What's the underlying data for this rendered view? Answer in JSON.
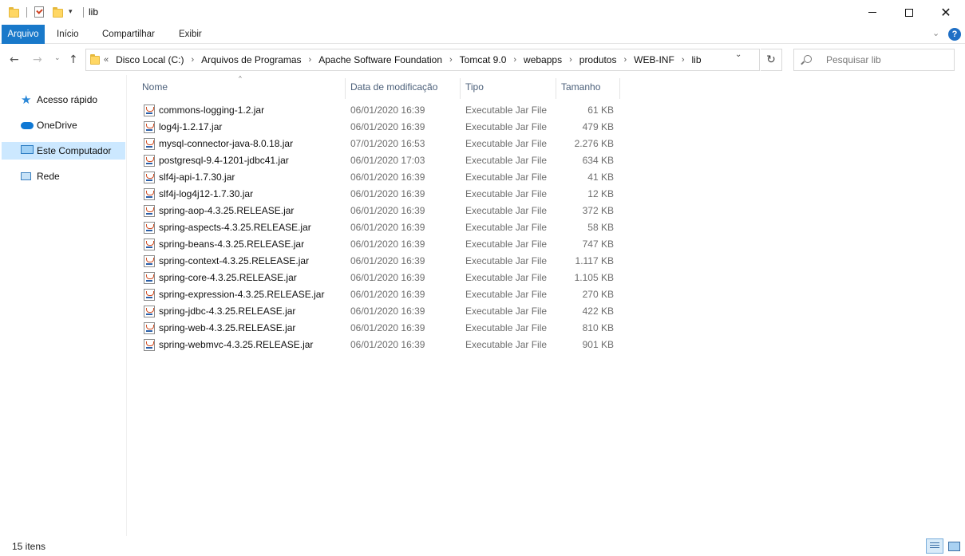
{
  "window": {
    "title": "lib",
    "minimize_icon": "minimize-icon",
    "maximize_icon": "maximize-icon",
    "close_glyph": "✕"
  },
  "ribbon": {
    "tabs": [
      "Arquivo",
      "Início",
      "Compartilhar",
      "Exibir"
    ],
    "accent_color": "#1979ca",
    "collapse_glyph": "⌄",
    "help_glyph": "?"
  },
  "nav": {
    "back_glyph": "←",
    "forward_glyph": "→",
    "recent_glyph": "⌄",
    "up_glyph": "↑",
    "overflow_glyph": "«",
    "breadcrumb": [
      "Disco Local (C:)",
      "Arquivos de Programas",
      "Apache Software Foundation",
      "Tomcat 9.0",
      "webapps",
      "produtos",
      "WEB-INF",
      "lib"
    ],
    "crumb_separator": "›",
    "dropdown_glyph": "⌄",
    "refresh_glyph": "↻",
    "search_placeholder": "Pesquisar lib"
  },
  "sidebar": {
    "items": [
      {
        "label": "Acesso rápido",
        "icon": "star-icon"
      },
      {
        "label": "OneDrive",
        "icon": "cloud-icon"
      },
      {
        "label": "Este Computador",
        "icon": "computer-icon",
        "selected": true
      },
      {
        "label": "Rede",
        "icon": "network-icon"
      }
    ],
    "selected_color": "#cce8ff"
  },
  "columns": {
    "name": "Nome",
    "date": "Data de modificação",
    "type": "Tipo",
    "size": "Tamanho",
    "sort_glyph": "^"
  },
  "files": [
    {
      "name": "commons-logging-1.2.jar",
      "date": "06/01/2020 16:39",
      "type": "Executable Jar File",
      "size": "61 KB"
    },
    {
      "name": "log4j-1.2.17.jar",
      "date": "06/01/2020 16:39",
      "type": "Executable Jar File",
      "size": "479 KB"
    },
    {
      "name": "mysql-connector-java-8.0.18.jar",
      "date": "07/01/2020 16:53",
      "type": "Executable Jar File",
      "size": "2.276 KB"
    },
    {
      "name": "postgresql-9.4-1201-jdbc41.jar",
      "date": "06/01/2020 17:03",
      "type": "Executable Jar File",
      "size": "634 KB"
    },
    {
      "name": "slf4j-api-1.7.30.jar",
      "date": "06/01/2020 16:39",
      "type": "Executable Jar File",
      "size": "41 KB"
    },
    {
      "name": "slf4j-log4j12-1.7.30.jar",
      "date": "06/01/2020 16:39",
      "type": "Executable Jar File",
      "size": "12 KB"
    },
    {
      "name": "spring-aop-4.3.25.RELEASE.jar",
      "date": "06/01/2020 16:39",
      "type": "Executable Jar File",
      "size": "372 KB"
    },
    {
      "name": "spring-aspects-4.3.25.RELEASE.jar",
      "date": "06/01/2020 16:39",
      "type": "Executable Jar File",
      "size": "58 KB"
    },
    {
      "name": "spring-beans-4.3.25.RELEASE.jar",
      "date": "06/01/2020 16:39",
      "type": "Executable Jar File",
      "size": "747 KB"
    },
    {
      "name": "spring-context-4.3.25.RELEASE.jar",
      "date": "06/01/2020 16:39",
      "type": "Executable Jar File",
      "size": "1.117 KB"
    },
    {
      "name": "spring-core-4.3.25.RELEASE.jar",
      "date": "06/01/2020 16:39",
      "type": "Executable Jar File",
      "size": "1.105 KB"
    },
    {
      "name": "spring-expression-4.3.25.RELEASE.jar",
      "date": "06/01/2020 16:39",
      "type": "Executable Jar File",
      "size": "270 KB"
    },
    {
      "name": "spring-jdbc-4.3.25.RELEASE.jar",
      "date": "06/01/2020 16:39",
      "type": "Executable Jar File",
      "size": "422 KB"
    },
    {
      "name": "spring-web-4.3.25.RELEASE.jar",
      "date": "06/01/2020 16:39",
      "type": "Executable Jar File",
      "size": "810 KB"
    },
    {
      "name": "spring-webmvc-4.3.25.RELEASE.jar",
      "date": "06/01/2020 16:39",
      "type": "Executable Jar File",
      "size": "901 KB"
    }
  ],
  "status": {
    "item_count": "15 itens"
  }
}
